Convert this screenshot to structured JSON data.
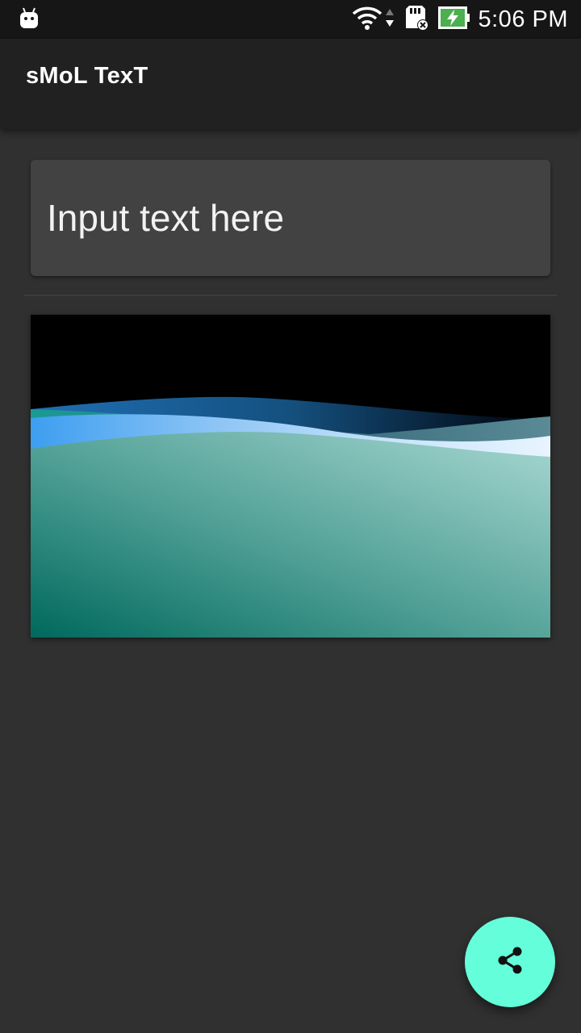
{
  "status_bar": {
    "time": "5:06 PM",
    "icons": [
      "android-notification-icon",
      "wifi-icon",
      "data-arrows-icon",
      "sd-card-icon",
      "battery-charging-icon"
    ]
  },
  "app_bar": {
    "title": "sMoL TexT"
  },
  "input": {
    "placeholder": "Input text here",
    "value": ""
  },
  "preview": {
    "description_icon": "wave-wallpaper-image"
  },
  "fab": {
    "icon": "share-icon",
    "color": "#64FFDA"
  },
  "colors": {
    "background": "#303030",
    "app_bar": "#212121",
    "status_bar": "#161616",
    "card": "#424242",
    "accent": "#64FFDA"
  }
}
